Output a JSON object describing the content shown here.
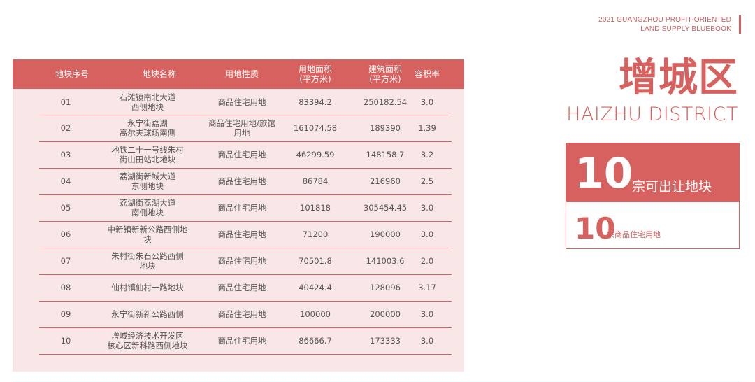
{
  "header": {
    "line1": "2021 GUANGZHOU PROFIT-ORIENTED",
    "line2": "LAND SUPPLY BLUEBOOK"
  },
  "district": {
    "name_cn": "增城区",
    "name_en": "HAIZHU DISTRICT"
  },
  "stats": {
    "total_count": "10",
    "total_label": "宗可出让地块",
    "residential_count": "10",
    "residential_label": "宗商品住宅用地"
  },
  "table": {
    "headers": [
      "地块序号",
      "地块名称",
      "用地性质",
      "用地面积\n(平方米)",
      "建筑面积\n(平方米)",
      "容积率"
    ],
    "rows": [
      [
        "01",
        "石滩镇南北大道\n西侧地块",
        "商品住宅用地",
        "83394.2",
        "250182.54",
        "3.0"
      ],
      [
        "02",
        "永宁街荔湖\n高尔夫球场南侧",
        "商品住宅用地/旅馆\n用地",
        "161074.58",
        "189390",
        "1.39"
      ],
      [
        "03",
        "地铁二十一号线朱村\n街山田站北地块",
        "商品住宅用地",
        "46299.59",
        "148158.7",
        "3.2"
      ],
      [
        "04",
        "荔湖街新城大道\n东侧地块",
        "商品住宅用地",
        "86784",
        "216960",
        "2.5"
      ],
      [
        "05",
        "荔湖街荔湖大道\n南侧地块",
        "商品住宅用地",
        "101818",
        "305454.45",
        "3.0"
      ],
      [
        "06",
        "中新镇新新公路西侧地\n块",
        "商品住宅用地",
        "71200",
        "190000",
        "3.0"
      ],
      [
        "07",
        "朱村街朱石公路西侧\n地块",
        "商品住宅用地",
        "70501.8",
        "141003.6",
        "2.0"
      ],
      [
        "08",
        "仙村镇仙村一路地块",
        "商品住宅用地",
        "40424.4",
        "128096",
        "3.17"
      ],
      [
        "09",
        "永宁街新新公路西侧",
        "商品住宅用地",
        "100000",
        "200000",
        "3.0"
      ],
      [
        "10",
        "增城经济技术开发区\n核心区新科路西侧地块",
        "商品住宅用地",
        "86666.7",
        "173333",
        "3.0"
      ]
    ]
  },
  "colors": {
    "accent": "#d7615e",
    "panel_bg": "#f9e6e6"
  }
}
